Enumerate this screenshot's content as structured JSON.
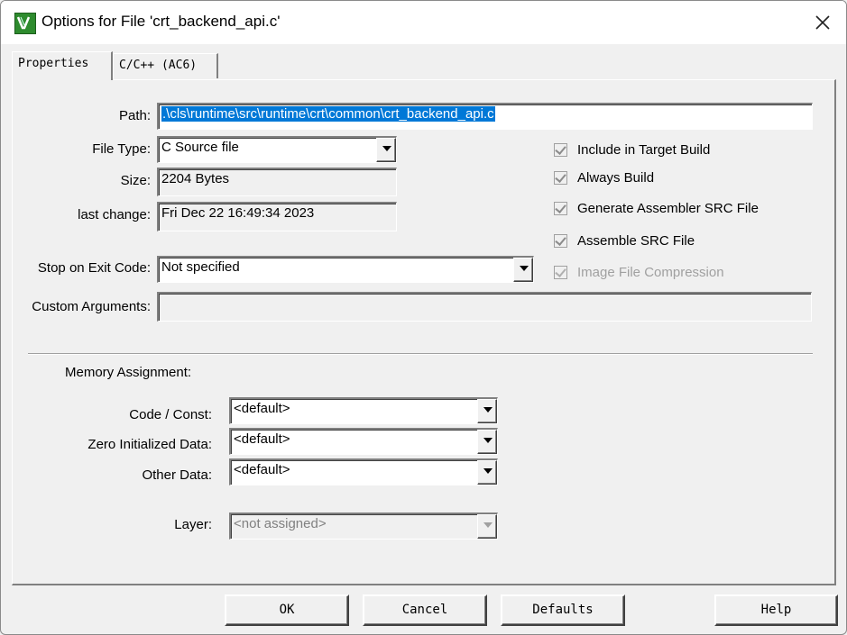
{
  "window": {
    "title": "Options for File 'crt_backend_api.c'"
  },
  "tabs": [
    {
      "label": "Properties"
    },
    {
      "label": "C/C++ (AC6)"
    }
  ],
  "properties": {
    "path_label": "Path:",
    "path_value": ".\\cls\\runtime\\src\\runtime\\crt\\common\\crt_backend_api.c",
    "file_type_label": "File Type:",
    "file_type_value": "C Source file",
    "size_label": "Size:",
    "size_value": "2204 Bytes",
    "last_change_label": "last change:",
    "last_change_value": "Fri Dec 22 16:49:34 2023",
    "stop_label": "Stop on Exit Code:",
    "stop_value": "Not specified",
    "custom_args_label": "Custom Arguments:",
    "custom_args_value": ""
  },
  "checkboxes": [
    {
      "label": "Include in Target Build",
      "checked": true,
      "enabled": true
    },
    {
      "label": "Always Build",
      "checked": true,
      "enabled": true
    },
    {
      "label": "Generate Assembler SRC File",
      "checked": true,
      "enabled": true
    },
    {
      "label": "Assemble SRC File",
      "checked": true,
      "enabled": true
    },
    {
      "label": "Image File Compression",
      "checked": true,
      "enabled": false
    }
  ],
  "memory": {
    "heading": "Memory Assignment:",
    "code_label": "Code / Const:",
    "code_value": "<default>",
    "zero_label": "Zero Initialized Data:",
    "zero_value": "<default>",
    "other_label": "Other Data:",
    "other_value": "<default>",
    "layer_label": "Layer:",
    "layer_value": "<not assigned>"
  },
  "buttons": {
    "ok": "OK",
    "cancel": "Cancel",
    "defaults": "Defaults",
    "help": "Help"
  }
}
